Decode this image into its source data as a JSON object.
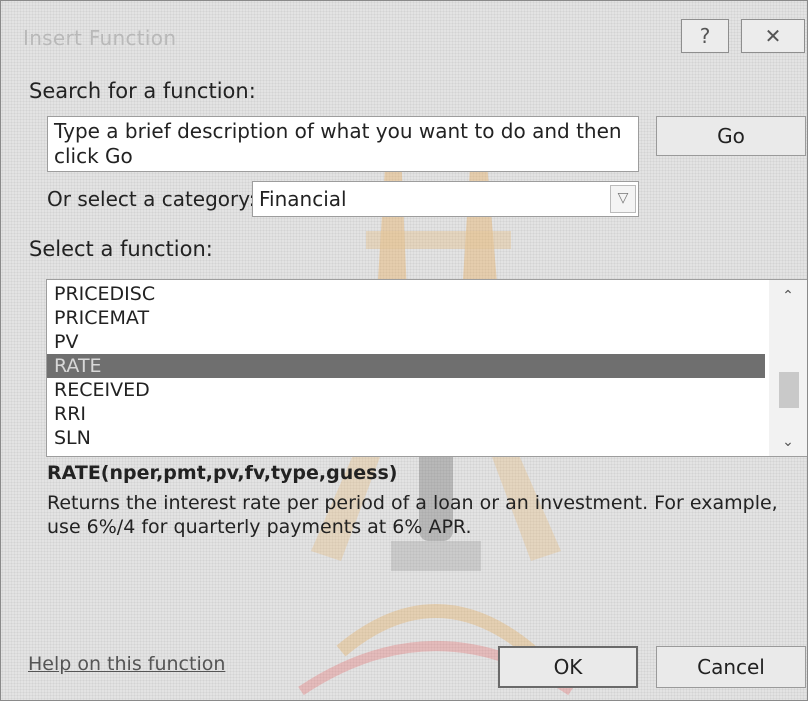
{
  "window": {
    "title": "Insert Function",
    "help_glyph": "?",
    "close_glyph": "✕"
  },
  "search": {
    "label": "Search for a function:",
    "value": "Type a brief description of what you want to do and then click Go",
    "go_label": "Go"
  },
  "category": {
    "label": "Or select a category:",
    "selected": "Financial"
  },
  "functions": {
    "label": "Select a function:",
    "items": [
      "PRICEDISC",
      "PRICEMAT",
      "PV",
      "RATE",
      "RECEIVED",
      "RRI",
      "SLN"
    ],
    "selected": "RATE",
    "signature": "RATE(nper,pmt,pv,fv,type,guess)",
    "description": "Returns the interest rate per period of a loan or an investment. For example, use 6%/4 for quarterly payments at 6% APR."
  },
  "footer": {
    "help_link": "Help on this function",
    "ok_label": "OK",
    "cancel_label": "Cancel"
  },
  "colors": {
    "selection": "#6f6f6f",
    "dialog_bg": "#e3e3e3",
    "watermark_orange": "#e8a040",
    "watermark_red": "#e84040"
  }
}
